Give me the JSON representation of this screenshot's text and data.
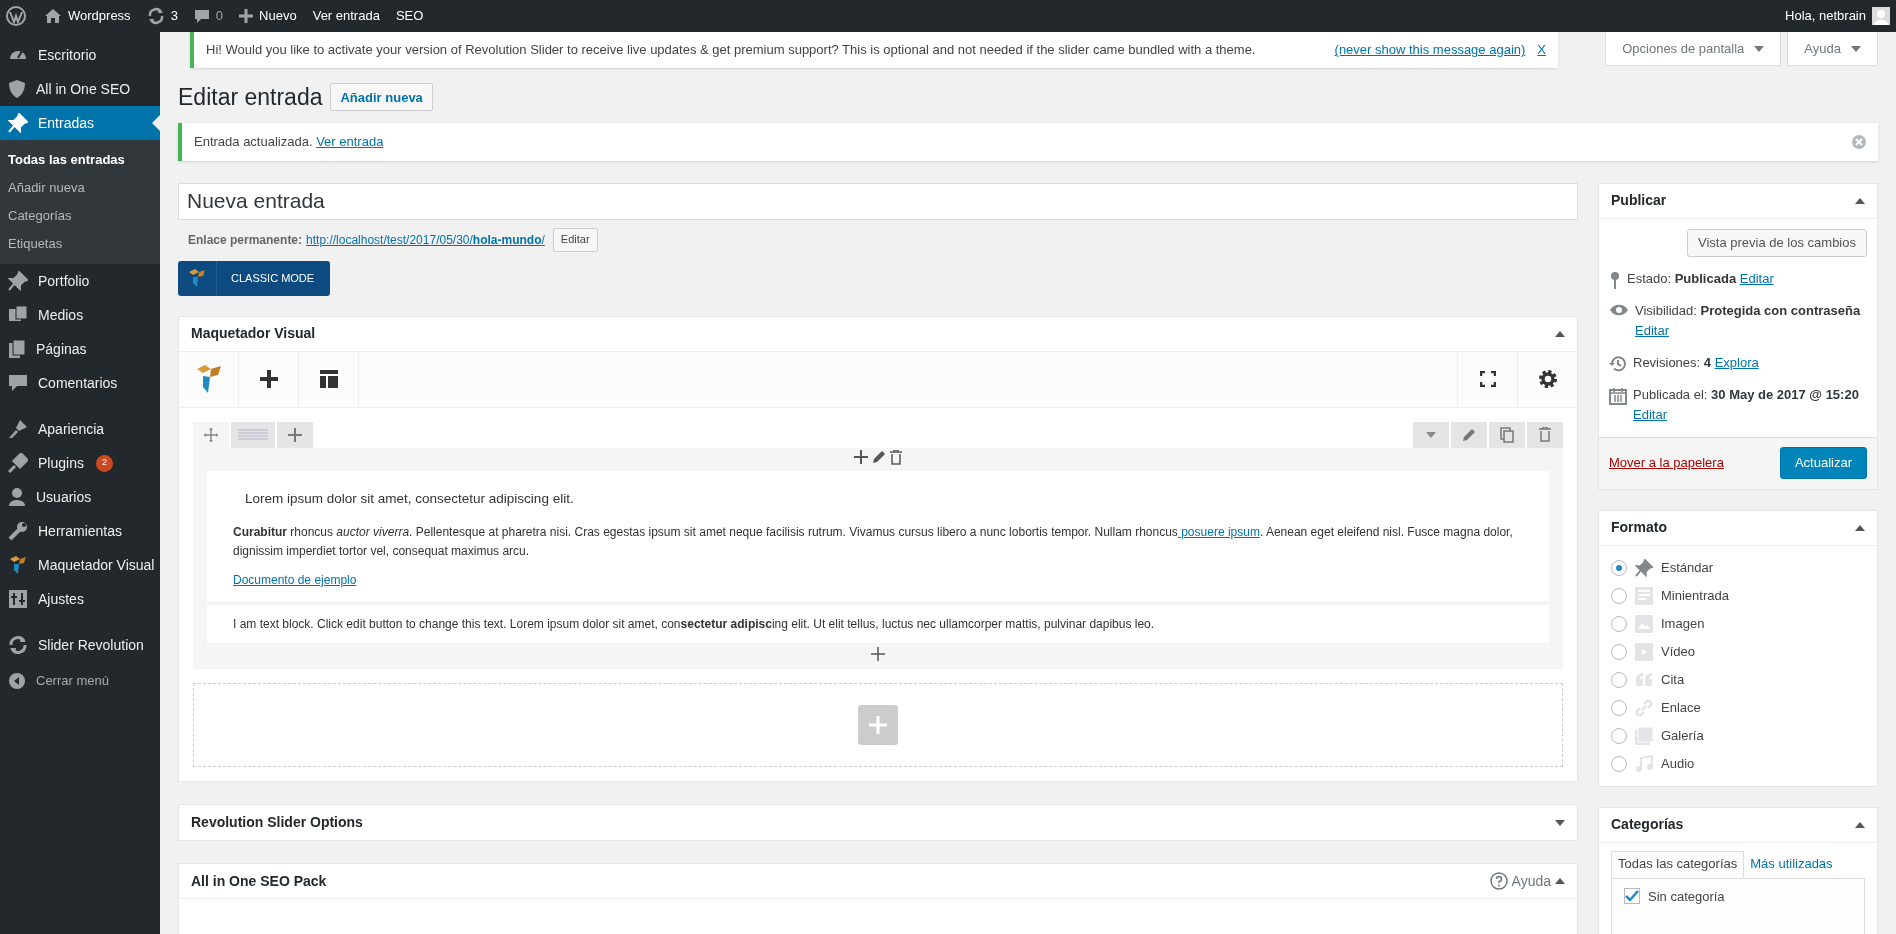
{
  "admin_bar": {
    "site": "Wordpress",
    "updates": "3",
    "comments": "0",
    "new": "Nuevo",
    "links": [
      "Ver entrada",
      "SEO"
    ],
    "greeting": "Hola, netbrain"
  },
  "sidebar": {
    "groups": [
      [
        {
          "label": "Escritorio",
          "selected": false
        },
        {
          "label": "All in One SEO",
          "selected": false
        },
        {
          "label": "Entradas",
          "selected": true,
          "children": [
            {
              "label": "Todas las entradas",
              "selected": true
            },
            {
              "label": "Añadir nueva",
              "selected": false
            },
            {
              "label": "Categorías",
              "selected": false
            },
            {
              "label": "Etiquetas",
              "selected": false
            }
          ]
        },
        {
          "label": "Portfolio",
          "selected": false
        },
        {
          "label": "Medios",
          "selected": false
        },
        {
          "label": "Páginas",
          "selected": false
        },
        {
          "label": "Comentarios",
          "selected": false
        }
      ],
      [
        {
          "label": "Apariencia",
          "selected": false
        },
        {
          "label": "Plugins",
          "selected": false,
          "badge": "2"
        },
        {
          "label": "Usuarios",
          "selected": false
        },
        {
          "label": "Herramientas",
          "selected": false
        },
        {
          "label": "Maquetador Visual",
          "selected": false
        },
        {
          "label": "Ajustes",
          "selected": false
        }
      ],
      [
        {
          "label": "Slider Revolution",
          "selected": false
        }
      ]
    ],
    "collapse": "Cerrar menú"
  },
  "slider_notice": {
    "text": "Hi! Would you like to activate your version of Revolution Slider to receive live updates & get premium support? This is optional and not needed if the slider came bundled with a theme.",
    "link": "(never show this message again)",
    "dismiss": "X"
  },
  "screen_tabs": [
    "Opciones de pantalla",
    "Ayuda"
  ],
  "heading": "Editar entrada",
  "add_new": "Añadir nueva",
  "updated_notice": {
    "text": "Entrada actualizada.",
    "link": "Ver entrada"
  },
  "title_field": {
    "value": "Nueva entrada"
  },
  "permalink": {
    "label": "Enlace permanente:",
    "url": "http://localhost/test/2017/05/30/**hola-mundo**/",
    "edit": "Editar"
  },
  "classic_mode": "CLASSIC MODE",
  "builder": {
    "title": "Maquetador Visual",
    "expanded": true,
    "block_1": {
      "lead": "Lorem ipsum dolor sit amet, consectetur adipiscing elit.",
      "text_before": "**Curabitur** rhoncus *auctor viverra*. Pellentesque at pharetra nisi. Cras egestas ipsum sit amet neque facilisis rutrum. Vivamus cursus libero a nunc lobortis tempor. Nullam rhoncus",
      "link": " posuere ipsum",
      "text_after": ". Aenean eget eleifend nisl. Fusce magna dolor, dignissim imperdiet tortor vel, consequat maximus arcu.",
      "doc_link": "Documento de ejemplo"
    },
    "block_2": "I am text block. Click edit button to change this text. Lorem ipsum dolor sit amet, con**sectetur adipisc**ing elit. Ut elit tellus, luctus nec ullamcorper mattis, pulvinar dapibus leo."
  },
  "boxes": [
    {
      "title": "Revolution Slider Options",
      "expanded": false
    },
    {
      "title": "All in One SEO Pack",
      "expanded": true,
      "help": "Ayuda"
    }
  ],
  "publish": {
    "title": "Publicar",
    "expanded": true,
    "preview": "Vista previa de los cambios",
    "rows": [
      {
        "label": "Estado:",
        "value": "Publicada",
        "link": "Editar"
      },
      {
        "label": "Visibilidad:",
        "value": "Protegida con contraseña",
        "link": "Editar"
      },
      {
        "label": "Revisiones:",
        "value": "4",
        "link": "Explora"
      },
      {
        "label": "Publicada el:",
        "value": "30 May de 2017 @ 15:20",
        "link": "Editar"
      }
    ],
    "trash": "Mover a la papelera",
    "update": "Actualizar"
  },
  "format": {
    "title": "Formato",
    "expanded": true,
    "options": [
      {
        "label": "Estándar",
        "selected": true
      },
      {
        "label": "Minientrada",
        "selected": false
      },
      {
        "label": "Imagen",
        "selected": false
      },
      {
        "label": "Vídeo",
        "selected": false
      },
      {
        "label": "Cita",
        "selected": false
      },
      {
        "label": "Enlace",
        "selected": false
      },
      {
        "label": "Galería",
        "selected": false
      },
      {
        "label": "Audio",
        "selected": false
      }
    ]
  },
  "categories": {
    "title": "Categorías",
    "expanded": true,
    "tabs": [
      {
        "label": "Todas las categorías",
        "selected": true
      },
      {
        "label": "Más utilizadas",
        "selected": false
      }
    ],
    "items": [
      {
        "label": "Sin categoría",
        "checked": true
      }
    ]
  }
}
